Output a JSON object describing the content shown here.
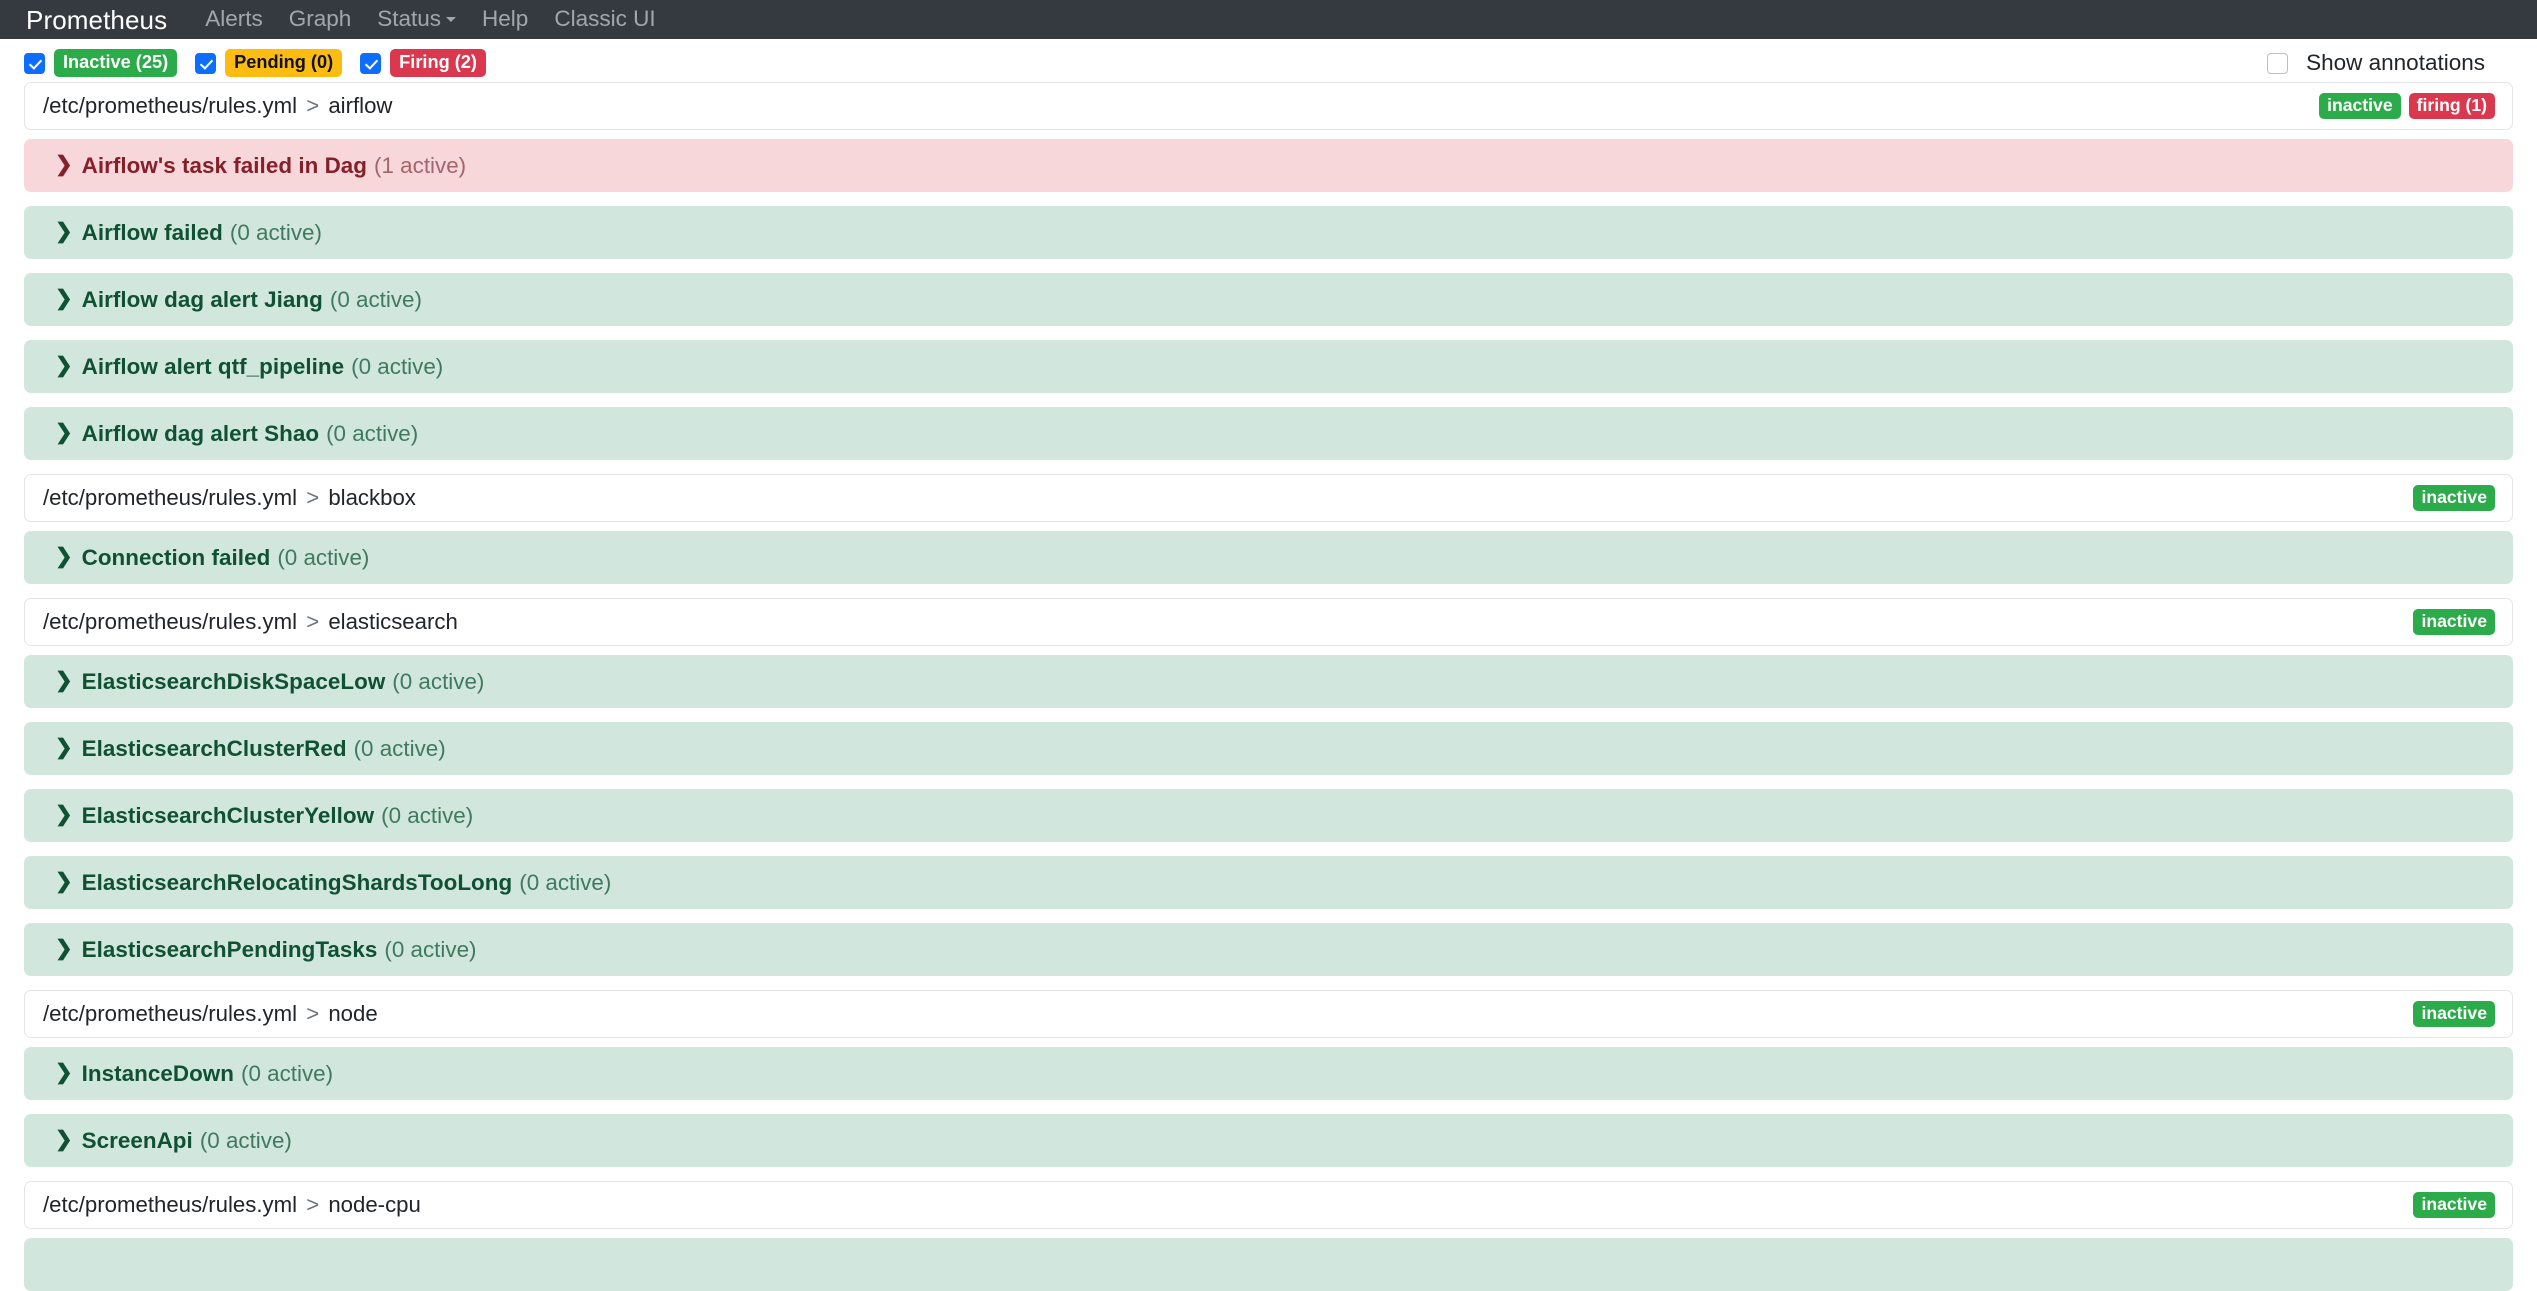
{
  "navbar": {
    "brand": "Prometheus",
    "links": [
      {
        "label": "Alerts",
        "has_caret": false
      },
      {
        "label": "Graph",
        "has_caret": false
      },
      {
        "label": "Status",
        "has_caret": true
      },
      {
        "label": "Help",
        "has_caret": false
      },
      {
        "label": "Classic UI",
        "has_caret": false
      }
    ]
  },
  "filters": {
    "items": [
      {
        "label": "Inactive (25)",
        "state": "inactive",
        "checked": true
      },
      {
        "label": "Pending (0)",
        "state": "pending",
        "checked": true
      },
      {
        "label": "Firing (2)",
        "state": "firing",
        "checked": true
      }
    ],
    "show_annotations": {
      "label": "Show annotations",
      "checked": false
    }
  },
  "colors": {
    "navbar_bg": "#343a40",
    "inactive": "#2cab4a",
    "pending": "#fdbc11",
    "firing": "#d9384f",
    "row_ok_bg": "#d1e7dd",
    "row_bad_bg": "#f8d7da",
    "checkbox_accent": "#0d6efd"
  },
  "groups": [
    {
      "file": "/etc/prometheus/rules.yml",
      "separator": ">",
      "name": "airflow",
      "badges": [
        {
          "label": "inactive",
          "color": "green"
        },
        {
          "label": "firing (1)",
          "color": "red"
        }
      ],
      "rules": [
        {
          "name": "Airflow's task failed in Dag",
          "count": "(1 active)",
          "state": "firing"
        },
        {
          "name": "Airflow failed",
          "count": "(0 active)",
          "state": "inactive"
        },
        {
          "name": "Airflow dag alert Jiang",
          "count": "(0 active)",
          "state": "inactive"
        },
        {
          "name": "Airflow alert qtf_pipeline",
          "count": "(0 active)",
          "state": "inactive"
        },
        {
          "name": "Airflow dag alert Shao",
          "count": "(0 active)",
          "state": "inactive"
        }
      ]
    },
    {
      "file": "/etc/prometheus/rules.yml",
      "separator": ">",
      "name": "blackbox",
      "badges": [
        {
          "label": "inactive",
          "color": "green"
        }
      ],
      "rules": [
        {
          "name": "Connection failed",
          "count": "(0 active)",
          "state": "inactive"
        }
      ]
    },
    {
      "file": "/etc/prometheus/rules.yml",
      "separator": ">",
      "name": "elasticsearch",
      "badges": [
        {
          "label": "inactive",
          "color": "green"
        }
      ],
      "rules": [
        {
          "name": "ElasticsearchDiskSpaceLow",
          "count": "(0 active)",
          "state": "inactive"
        },
        {
          "name": "ElasticsearchClusterRed",
          "count": "(0 active)",
          "state": "inactive"
        },
        {
          "name": "ElasticsearchClusterYellow",
          "count": "(0 active)",
          "state": "inactive"
        },
        {
          "name": "ElasticsearchRelocatingShardsTooLong",
          "count": "(0 active)",
          "state": "inactive"
        },
        {
          "name": "ElasticsearchPendingTasks",
          "count": "(0 active)",
          "state": "inactive"
        }
      ]
    },
    {
      "file": "/etc/prometheus/rules.yml",
      "separator": ">",
      "name": "node",
      "badges": [
        {
          "label": "inactive",
          "color": "green"
        }
      ],
      "rules": [
        {
          "name": "InstanceDown",
          "count": "(0 active)",
          "state": "inactive"
        },
        {
          "name": "ScreenApi",
          "count": "(0 active)",
          "state": "inactive"
        }
      ]
    },
    {
      "file": "/etc/prometheus/rules.yml",
      "separator": ">",
      "name": "node-cpu",
      "badges": [
        {
          "label": "inactive",
          "color": "green"
        }
      ],
      "rules": [
        {
          "name": "",
          "count": "",
          "state": "inactive"
        }
      ]
    }
  ],
  "icons": {
    "chevron_right": "❯",
    "caret_down": "caret-down-icon"
  }
}
